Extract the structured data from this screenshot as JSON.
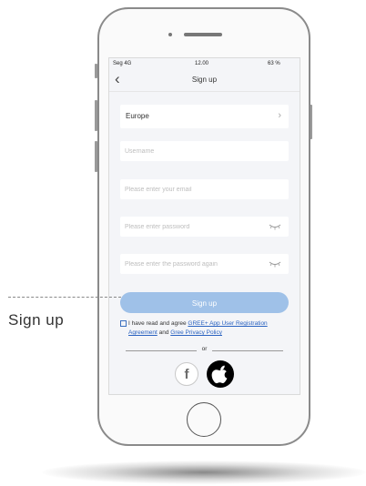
{
  "status_bar": {
    "carrier": "Seg 4G",
    "time": "12.00",
    "battery": "63 %"
  },
  "header": {
    "back_icon": "chevron-left-icon",
    "title": "Sign up"
  },
  "form": {
    "region": "Europe",
    "username_placeholder": "Username",
    "email_placeholder": "Please enter your email",
    "password_placeholder": "Please enter password",
    "password_again_placeholder": "Please enter the password again"
  },
  "signup_button": "Sign up",
  "agreement": {
    "prefix": "I have read and agree ",
    "user_agreement": "GREE+ App User Registration Agreement",
    "and": " and ",
    "privacy_policy": "Gree Privacy Policy"
  },
  "divider_text": "or",
  "social": {
    "facebook": "f",
    "facebook_icon": "facebook-icon",
    "apple_icon": "apple-icon"
  },
  "callout_label": "Sign up",
  "colors": {
    "primary_button": "#9fc1e8",
    "link": "#2a62c0"
  }
}
